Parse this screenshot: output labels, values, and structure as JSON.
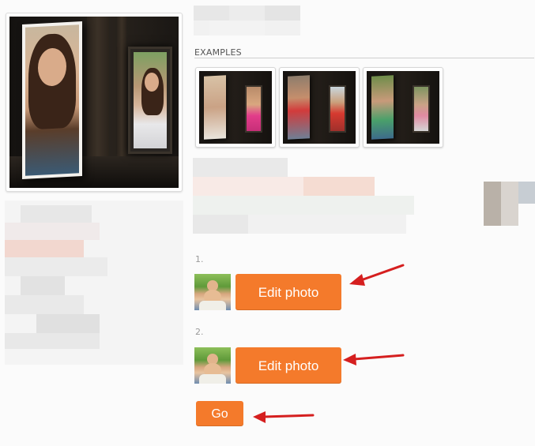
{
  "examples": {
    "label": "EXAMPLES",
    "thumbnails": [
      {
        "name": "example-1"
      },
      {
        "name": "example-2"
      },
      {
        "name": "example-3"
      }
    ]
  },
  "steps": [
    {
      "number": "1.",
      "button_label": "Edit photo"
    },
    {
      "number": "2.",
      "button_label": "Edit photo"
    }
  ],
  "go_button": {
    "label": "Go"
  },
  "colors": {
    "button": "#f47a2b",
    "arrow": "#d51f1f",
    "rule": "#cfcfcf"
  },
  "icons": [
    "arrow-left-icon"
  ]
}
